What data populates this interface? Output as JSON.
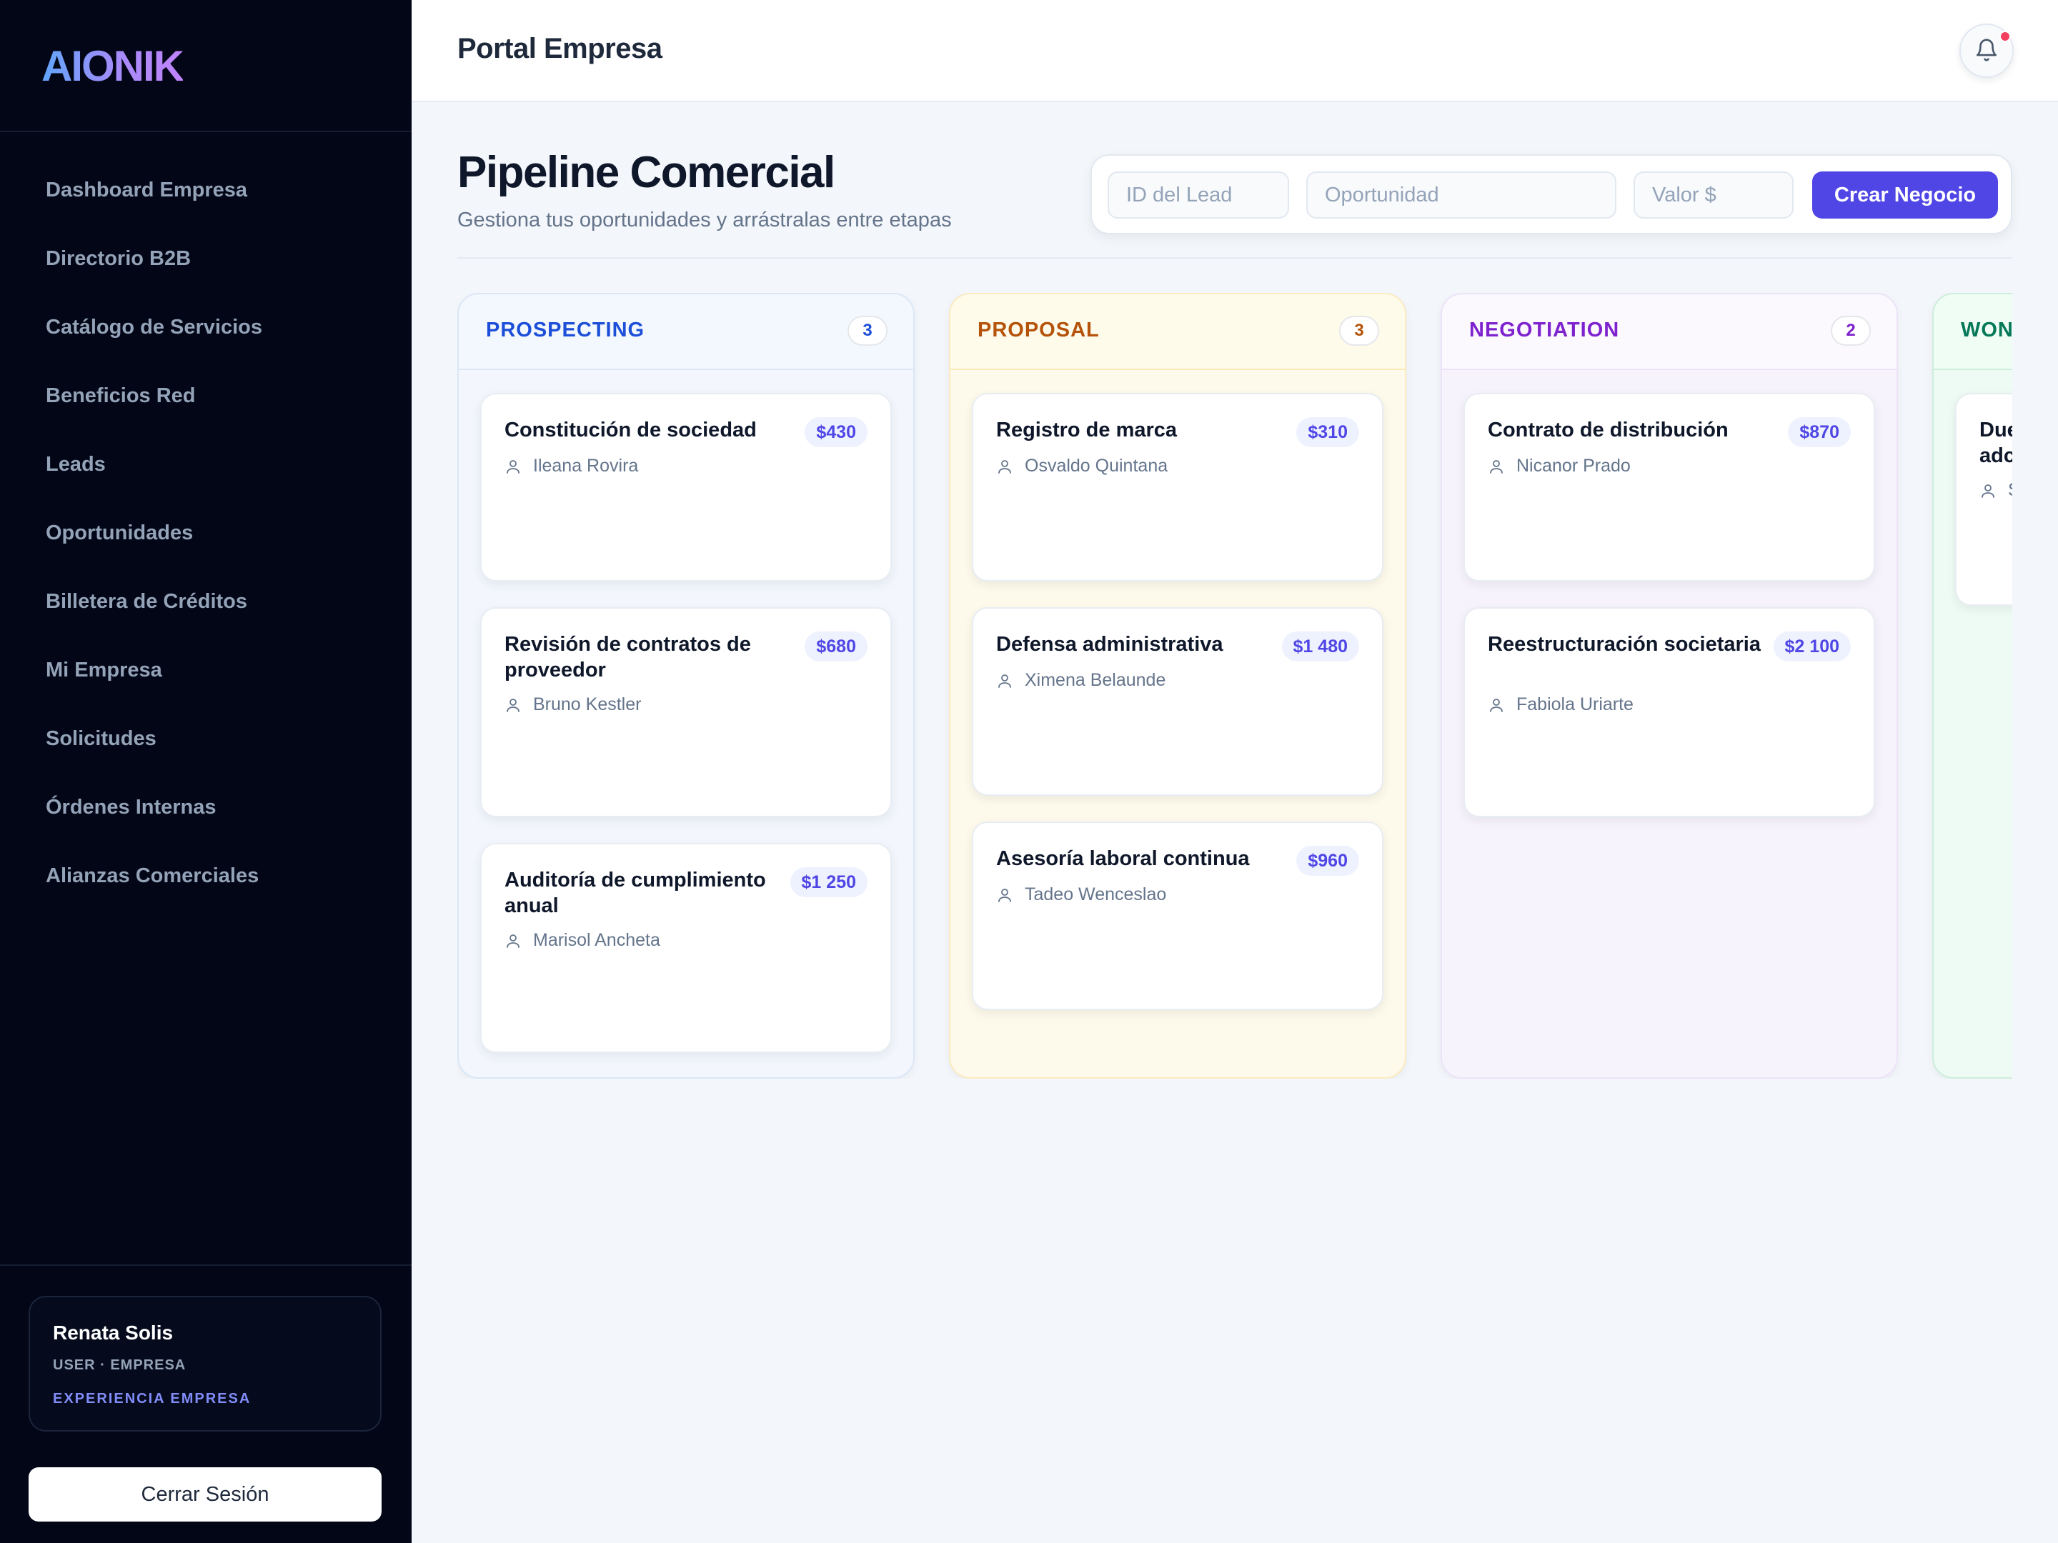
{
  "brand": {
    "logo": "AIONIK"
  },
  "sidebar": {
    "items": [
      {
        "label": "Dashboard Empresa"
      },
      {
        "label": "Directorio B2B"
      },
      {
        "label": "Catálogo de Servicios"
      },
      {
        "label": "Beneficios Red"
      },
      {
        "label": "Leads"
      },
      {
        "label": "Oportunidades"
      },
      {
        "label": "Billetera de Créditos"
      },
      {
        "label": "Mi Empresa"
      },
      {
        "label": "Solicitudes"
      },
      {
        "label": "Órdenes Internas"
      },
      {
        "label": "Alianzas Comerciales"
      }
    ]
  },
  "user": {
    "name": "Renata Solis",
    "role": "USER · EMPRESA",
    "experience": "EXPERIENCIA EMPRESA",
    "logout_label": "Cerrar Sesión"
  },
  "header": {
    "title": "Portal Empresa",
    "notification_icon": "bell-icon",
    "has_unread": true
  },
  "page": {
    "title": "Pipeline Comercial",
    "subtitle": "Gestiona tus oportunidades y arrástralas entre etapas"
  },
  "create_form": {
    "lead_id_placeholder": "ID del Lead",
    "opportunity_placeholder": "Oportunidad",
    "value_placeholder": "Valor $",
    "submit_label": "Crear Negocio"
  },
  "colors": {
    "accent": "#4f46e5",
    "sidebar_bg": "#020617",
    "prospecting": "#1d4ed8",
    "proposal": "#b45309",
    "negotiation": "#7e22ce",
    "won": "#047857"
  },
  "columns": [
    {
      "name": "PROSPECTING",
      "count": "3",
      "cards": [
        {
          "title": "Constitución de sociedad",
          "price": "$430",
          "person": "Ileana Rovira"
        },
        {
          "title": "Revisión de contratos de proveedor",
          "price": "$680",
          "person": "Bruno Kestler"
        },
        {
          "title": "Auditoría de cumplimiento anual",
          "price": "$1 250",
          "person": "Marisol Ancheta"
        }
      ]
    },
    {
      "name": "PROPOSAL",
      "count": "3",
      "cards": [
        {
          "title": "Registro de marca",
          "price": "$310",
          "person": "Osvaldo Quintana"
        },
        {
          "title": "Defensa administrativa",
          "price": "$1 480",
          "person": "Ximena Belaunde"
        },
        {
          "title": "Asesoría laboral continua",
          "price": "$960",
          "person": "Tadeo Wenceslao"
        }
      ]
    },
    {
      "name": "NEGOTIATION",
      "count": "2",
      "cards": [
        {
          "title": "Contrato de distribución",
          "price": "$870",
          "person": "Nicanor Prado"
        },
        {
          "title": "Reestructuración societaria",
          "price": "$2 100",
          "person": "Fabiola Uriarte"
        }
      ]
    },
    {
      "name": "WON",
      "count": "",
      "cards": [
        {
          "title": "Due",
          "title_line2": "adc",
          "price": "",
          "person": "S"
        }
      ]
    }
  ]
}
